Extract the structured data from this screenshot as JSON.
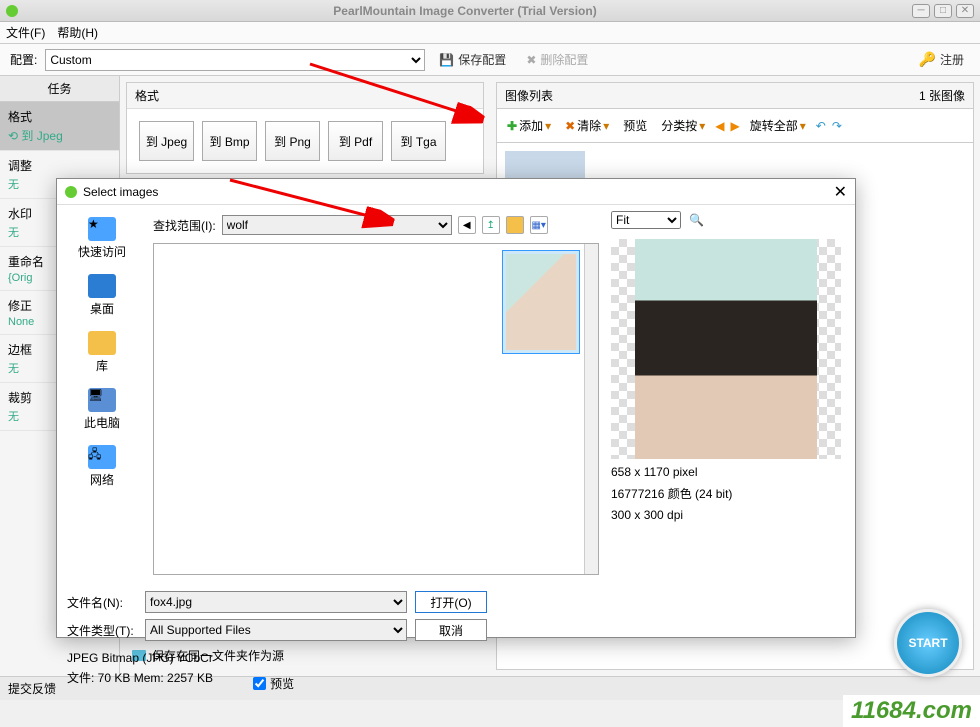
{
  "window": {
    "title": "PearlMountain Image Converter (Trial Version)"
  },
  "menu": {
    "file": "文件(F)",
    "help": "帮助(H)"
  },
  "toolbar": {
    "config_label": "配置:",
    "preset": "Custom",
    "save_config": "保存配置",
    "delete_config": "删除配置",
    "register": "注册"
  },
  "sidebar": {
    "header": "任务",
    "items": [
      {
        "title": "格式",
        "sub": "到 Jpeg"
      },
      {
        "title": "调整",
        "sub": "无"
      },
      {
        "title": "水印",
        "sub": "无"
      },
      {
        "title": "重命名",
        "sub": "{Orig"
      },
      {
        "title": "修正",
        "sub": "None"
      },
      {
        "title": "边框",
        "sub": "无"
      },
      {
        "title": "裁剪",
        "sub": "无"
      }
    ]
  },
  "format": {
    "header": "格式",
    "btns": [
      "到 Jpeg",
      "到 Bmp",
      "到 Png",
      "到 Pdf",
      "到 Tga"
    ]
  },
  "save_same": "保存在同一文件夹作为源",
  "imagelist": {
    "header": "图像列表",
    "count": "1 张图像",
    "add": "添加",
    "clear": "清除",
    "preview": "预览",
    "sort": "分类按",
    "rotate": "旋转全部"
  },
  "footer": {
    "feedback": "提交反馈"
  },
  "start": "START",
  "watermark": "11684.com",
  "dialog": {
    "title": "Select images",
    "lookin_label": "查找范围(I):",
    "lookin_value": "wolf",
    "fit": "Fit",
    "filename_label": "文件名(N):",
    "filename_value": "fox4.jpg",
    "filetype_label": "文件类型(T):",
    "filetype_value": "All Supported Files",
    "open": "打开(O)",
    "cancel": "取消",
    "preview_chk": "预览",
    "info1": "658 x 1170 pixel",
    "info2": "16777216 颜色 (24 bit)",
    "info3": "300 x 300 dpi",
    "status": "JPEG Bitmap (JPG) YCbCr",
    "mem": "文件: 70 KB   Mem: 2257 KB",
    "places": [
      "快速访问",
      "桌面",
      "库",
      "此电脑",
      "网络"
    ]
  }
}
